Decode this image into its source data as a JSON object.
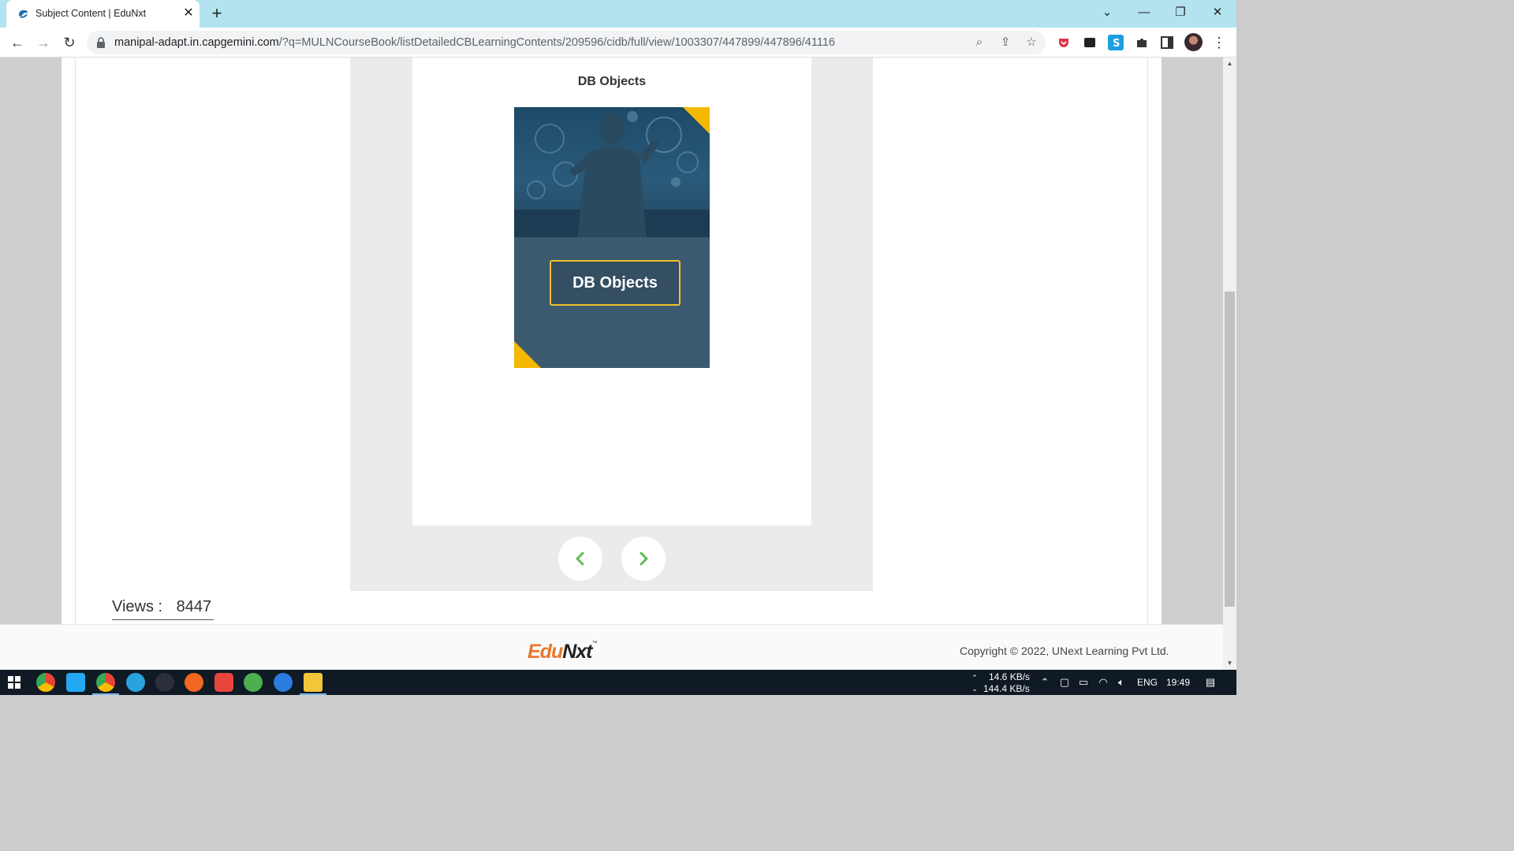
{
  "browser": {
    "tab_title": "Subject Content | EduNxt",
    "tab_close": "✕",
    "new_tab": "+",
    "url_host": "manipal-adapt.in.capgemini.com",
    "url_path": "/?q=MULNCourseBook/listDetailedCBLearningContents/209596/cidb/full/view/1003307/447899/447896/41116",
    "window_controls": {
      "dropdown": "⌄",
      "minimize": "—",
      "restore": "❐",
      "close": "✕"
    }
  },
  "viewer": {
    "title": "DB Objects",
    "cover_label": "DB Objects",
    "prev_icon": "chevron-left-icon",
    "next_icon": "chevron-right-icon",
    "accent_color": "#f5b800",
    "cover_color": "#3b5a70"
  },
  "stats": {
    "views_label": "Views :",
    "views_count": "8447"
  },
  "footer": {
    "logo_edu": "Edu",
    "logo_nxt": "Nxt",
    "copyright": "Copyright © 2022, UNext Learning Pvt Ltd."
  },
  "taskbar": {
    "net_up": "14.6 KB/s",
    "net_down": "144.4 KB/s",
    "lang": "ENG",
    "time": "19:49"
  }
}
